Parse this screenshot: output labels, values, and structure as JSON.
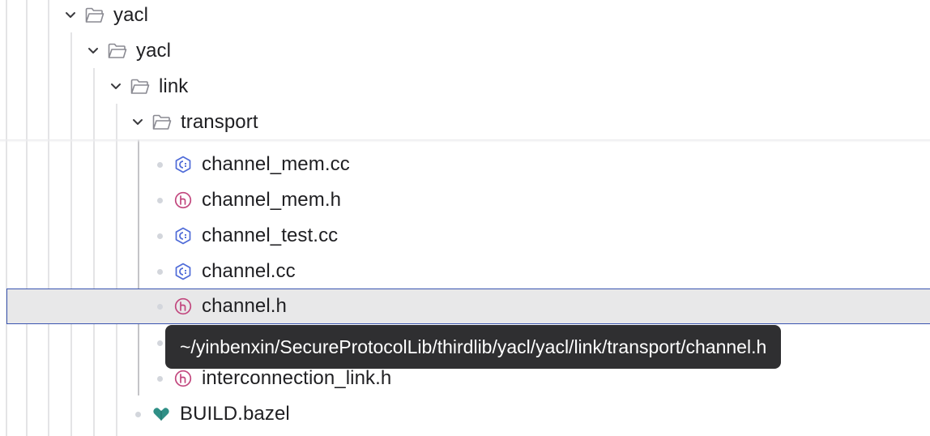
{
  "tree": {
    "folders": [
      {
        "label": "yacl",
        "expanded": true,
        "icon": "folder-open-icon"
      },
      {
        "label": "yacl",
        "expanded": true,
        "icon": "folder-open-icon"
      },
      {
        "label": "link",
        "expanded": true,
        "icon": "folder-open-icon"
      },
      {
        "label": "transport",
        "expanded": true,
        "icon": "folder-open-icon"
      }
    ],
    "files": [
      {
        "label": "channel_mem.cc",
        "icon": "cpp-file-icon"
      },
      {
        "label": "channel_mem.h",
        "icon": "header-file-icon"
      },
      {
        "label": "channel_test.cc",
        "icon": "cpp-file-icon"
      },
      {
        "label": "channel.cc",
        "icon": "cpp-file-icon"
      },
      {
        "label": "channel.h",
        "icon": "header-file-icon",
        "selected": true
      },
      {
        "label": "interconnection_link.h",
        "icon": "header-file-icon"
      },
      {
        "label": "BUILD.bazel",
        "icon": "bazel-file-icon"
      }
    ]
  },
  "tooltip": {
    "path": "~/yinbenxin/SecureProtocolLib/thirdlib/yacl/yacl/link/transport/channel.h"
  },
  "colors": {
    "selection_border": "#3a55b0",
    "selection_bg": "#e8e8e9",
    "cpp_icon": "#4f6bd8",
    "header_icon": "#c2477e",
    "bazel_icon": "#2f8f86",
    "tooltip_bg": "#2f2f31"
  }
}
